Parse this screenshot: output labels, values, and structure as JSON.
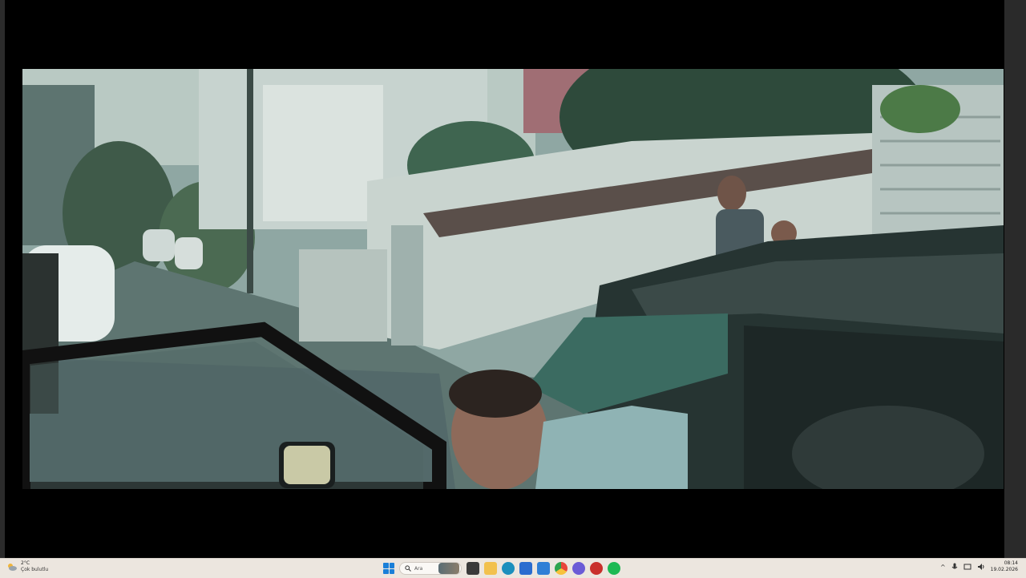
{
  "video": {
    "title": "",
    "scene_description_icons": [
      "street-scene"
    ]
  },
  "taskbar": {
    "weather": {
      "temp": "2°C",
      "condition": "Çok bulutlu",
      "icon": "cloud-sun-icon"
    },
    "search": {
      "placeholder": "Ara"
    },
    "apps": [
      {
        "name": "task-view-icon",
        "color": "#3a3a3a"
      },
      {
        "name": "file-explorer-icon",
        "color": "#f2c14e"
      },
      {
        "name": "edge-icon",
        "color": "#1b8fbd"
      },
      {
        "name": "store-icon",
        "color": "#2a6ccf"
      },
      {
        "name": "mail-icon",
        "color": "#2f7fd6"
      },
      {
        "name": "chrome-icon",
        "color": "#e8453c"
      },
      {
        "name": "messenger-icon",
        "color": "#6b5bd6"
      },
      {
        "name": "app-red-icon",
        "color": "#c9302c"
      },
      {
        "name": "spotify-icon",
        "color": "#1db954"
      }
    ],
    "tray": {
      "chevron": "^",
      "time": "08:14",
      "date": "19.02.2026"
    }
  }
}
